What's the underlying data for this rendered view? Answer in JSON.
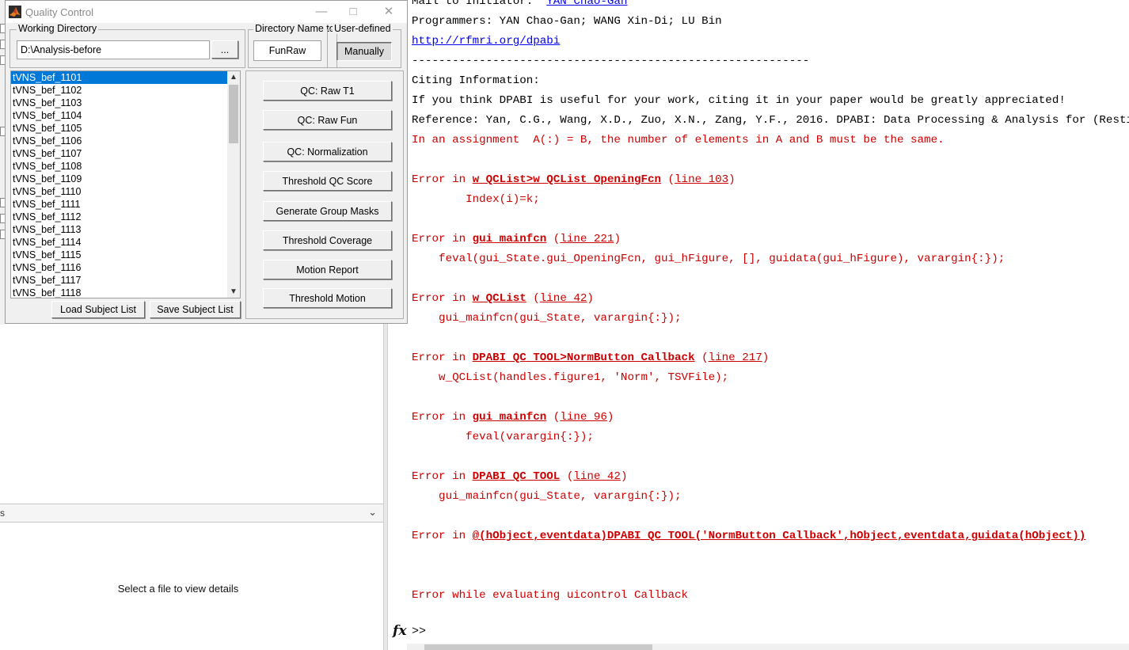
{
  "dialog": {
    "title": "Quality Control",
    "working_directory": {
      "label": "Working Directory",
      "value": "D:\\Analysis-before",
      "browse_label": "..."
    },
    "directory_name": {
      "label": "Directory Name to",
      "value": "FunRaw"
    },
    "user_defined": {
      "label": "User-defined",
      "button_label": "Manually"
    },
    "subjects": [
      "tVNS_bef_1101",
      "tVNS_bef_1102",
      "tVNS_bef_1103",
      "tVNS_bef_1104",
      "tVNS_bef_1105",
      "tVNS_bef_1106",
      "tVNS_bef_1107",
      "tVNS_bef_1108",
      "tVNS_bef_1109",
      "tVNS_bef_1110",
      "tVNS_bef_1111",
      "tVNS_bef_1112",
      "tVNS_bef_1113",
      "tVNS_bef_1114",
      "tVNS_bef_1115",
      "tVNS_bef_1116",
      "tVNS_bef_1117",
      "tVNS_bef_1118"
    ],
    "selected_subject": "tVNS_bef_1101",
    "load_label": "Load Subject List",
    "save_label": "Save Subject List",
    "actions": [
      "QC: Raw T1",
      "QC: Raw Fun",
      "QC: Normalization",
      "Threshold QC Score",
      "Generate Group Masks",
      "Threshold Coverage",
      "Motion Report",
      "Threshold Motion"
    ]
  },
  "details_panel": {
    "header": "s",
    "message": "Select a file to view details"
  },
  "command_window": {
    "lines": [
      {
        "segments": [
          {
            "t": "Mail to Initiator:  ",
            "c": "n"
          },
          {
            "t": "YAN Chao-Gan",
            "c": "lnk"
          }
        ]
      },
      {
        "segments": [
          {
            "t": "Programmers: YAN Chao-Gan; WANG Xin-Di; LU Bin",
            "c": "n"
          }
        ]
      },
      {
        "segments": [
          {
            "t": "http://rfmri.org/dpabi",
            "c": "lnk"
          }
        ]
      },
      {
        "segments": [
          {
            "t": "-----------------------------------------------------------",
            "c": "n"
          }
        ]
      },
      {
        "segments": [
          {
            "t": "Citing Information:",
            "c": "n"
          }
        ]
      },
      {
        "segments": [
          {
            "t": "If you think DPABI is useful for your work, citing it in your paper would be greatly appreciated!",
            "c": "n"
          }
        ]
      },
      {
        "segments": [
          {
            "t": "Reference: Yan, C.G., Wang, X.D., Zuo, X.N., Zang, Y.F., 2016. DPABI: Data Processing & Analysis for (Resting-Sta",
            "c": "n"
          }
        ]
      },
      {
        "segments": [
          {
            "t": "In an assignment  A(:) = B, the number of elements in A and B must be the same.",
            "c": "err"
          }
        ]
      },
      {
        "segments": [
          {
            "t": "",
            "c": "n"
          }
        ]
      },
      {
        "segments": [
          {
            "t": "Error in ",
            "c": "err"
          },
          {
            "t": "w_QCList>w_QCList_OpeningFcn",
            "c": "elnk"
          },
          {
            "t": " (",
            "c": "err"
          },
          {
            "t": "line 103",
            "c": "lnum"
          },
          {
            "t": ")",
            "c": "err"
          }
        ]
      },
      {
        "segments": [
          {
            "t": "        Index(i)=k;",
            "c": "err"
          }
        ]
      },
      {
        "segments": [
          {
            "t": "",
            "c": "n"
          }
        ]
      },
      {
        "segments": [
          {
            "t": "Error in ",
            "c": "err"
          },
          {
            "t": "gui_mainfcn",
            "c": "elnk"
          },
          {
            "t": " (",
            "c": "err"
          },
          {
            "t": "line 221",
            "c": "lnum"
          },
          {
            "t": ")",
            "c": "err"
          }
        ]
      },
      {
        "segments": [
          {
            "t": "    feval(gui_State.gui_OpeningFcn, gui_hFigure, [], guidata(gui_hFigure), varargin{:});",
            "c": "err"
          }
        ]
      },
      {
        "segments": [
          {
            "t": "",
            "c": "n"
          }
        ]
      },
      {
        "segments": [
          {
            "t": "Error in ",
            "c": "err"
          },
          {
            "t": "w_QCList",
            "c": "elnk"
          },
          {
            "t": " (",
            "c": "err"
          },
          {
            "t": "line 42",
            "c": "lnum"
          },
          {
            "t": ")",
            "c": "err"
          }
        ]
      },
      {
        "segments": [
          {
            "t": "    gui_mainfcn(gui_State, varargin{:});",
            "c": "err"
          }
        ]
      },
      {
        "segments": [
          {
            "t": "",
            "c": "n"
          }
        ]
      },
      {
        "segments": [
          {
            "t": "Error in ",
            "c": "err"
          },
          {
            "t": "DPABI_QC_TOOL>NormButton_Callback",
            "c": "elnk"
          },
          {
            "t": " (",
            "c": "err"
          },
          {
            "t": "line 217",
            "c": "lnum"
          },
          {
            "t": ")",
            "c": "err"
          }
        ]
      },
      {
        "segments": [
          {
            "t": "    w_QCList(handles.figure1, 'Norm', TSVFile);",
            "c": "err"
          }
        ]
      },
      {
        "segments": [
          {
            "t": "",
            "c": "n"
          }
        ]
      },
      {
        "segments": [
          {
            "t": "Error in ",
            "c": "err"
          },
          {
            "t": "gui_mainfcn",
            "c": "elnk"
          },
          {
            "t": " (",
            "c": "err"
          },
          {
            "t": "line 96",
            "c": "lnum"
          },
          {
            "t": ")",
            "c": "err"
          }
        ]
      },
      {
        "segments": [
          {
            "t": "        feval(varargin{:});",
            "c": "err"
          }
        ]
      },
      {
        "segments": [
          {
            "t": "",
            "c": "n"
          }
        ]
      },
      {
        "segments": [
          {
            "t": "Error in ",
            "c": "err"
          },
          {
            "t": "DPABI_QC_TOOL",
            "c": "elnk"
          },
          {
            "t": " (",
            "c": "err"
          },
          {
            "t": "line 42",
            "c": "lnum"
          },
          {
            "t": ")",
            "c": "err"
          }
        ]
      },
      {
        "segments": [
          {
            "t": "    gui_mainfcn(gui_State, varargin{:});",
            "c": "err"
          }
        ]
      },
      {
        "segments": [
          {
            "t": "",
            "c": "n"
          }
        ]
      },
      {
        "segments": [
          {
            "t": "Error in ",
            "c": "err"
          },
          {
            "t": "@(hObject,eventdata)DPABI_QC_TOOL('NormButton_Callback',hObject,eventdata,guidata(hObject))",
            "c": "elnk"
          }
        ]
      },
      {
        "segments": [
          {
            "t": "",
            "c": "n"
          }
        ]
      },
      {
        "segments": [
          {
            "t": "",
            "c": "n"
          }
        ]
      },
      {
        "segments": [
          {
            "t": "Error while evaluating uicontrol Callback",
            "c": "err"
          }
        ]
      }
    ],
    "fx_symbol": "fx",
    "prompt": ">>"
  }
}
